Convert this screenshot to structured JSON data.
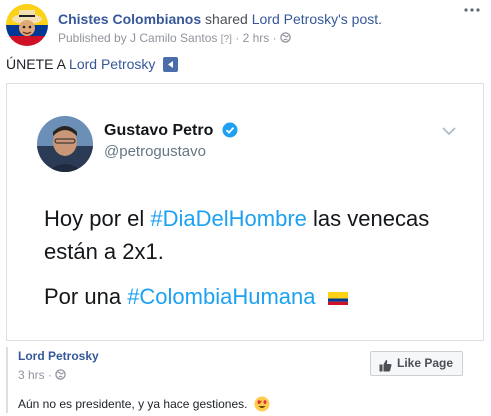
{
  "post": {
    "author": "Chistes Colombianos",
    "shared_text": "shared",
    "shared_target": "Lord Petrosky's post.",
    "published_by": "Published by J Camilo Santos",
    "help_marker": "[?]",
    "separator": "·",
    "time": "2 hrs",
    "separator2": "·",
    "text_prefix": "ÚNETE A",
    "text_link": "Lord Petrosky"
  },
  "tweet": {
    "name": "Gustavo Petro",
    "handle": "@petrogustavo",
    "line1_a": "Hoy por el",
    "line1_hash": "#DiaDelHombre",
    "line1_b": "las venecas están a 2x1.",
    "line2_a": "Por una",
    "line2_hash": "#ColombiaHumana"
  },
  "shared_page": {
    "name": "Lord Petrosky",
    "time": "3 hrs",
    "separator": "·",
    "like_label": "Like Page",
    "caption": "Aún no es presidente, y ya hace gestiones."
  },
  "colors": {
    "link": "#365899",
    "hashtag": "#1da1f2",
    "verified": "#1da1f2"
  },
  "icons": [
    "globe-icon",
    "more-options-icon",
    "video-play-icon",
    "verified-badge-icon",
    "chevron-down-icon",
    "colombia-flag-icon",
    "thumbs-up-icon",
    "heart-eyes-emoji-icon"
  ]
}
